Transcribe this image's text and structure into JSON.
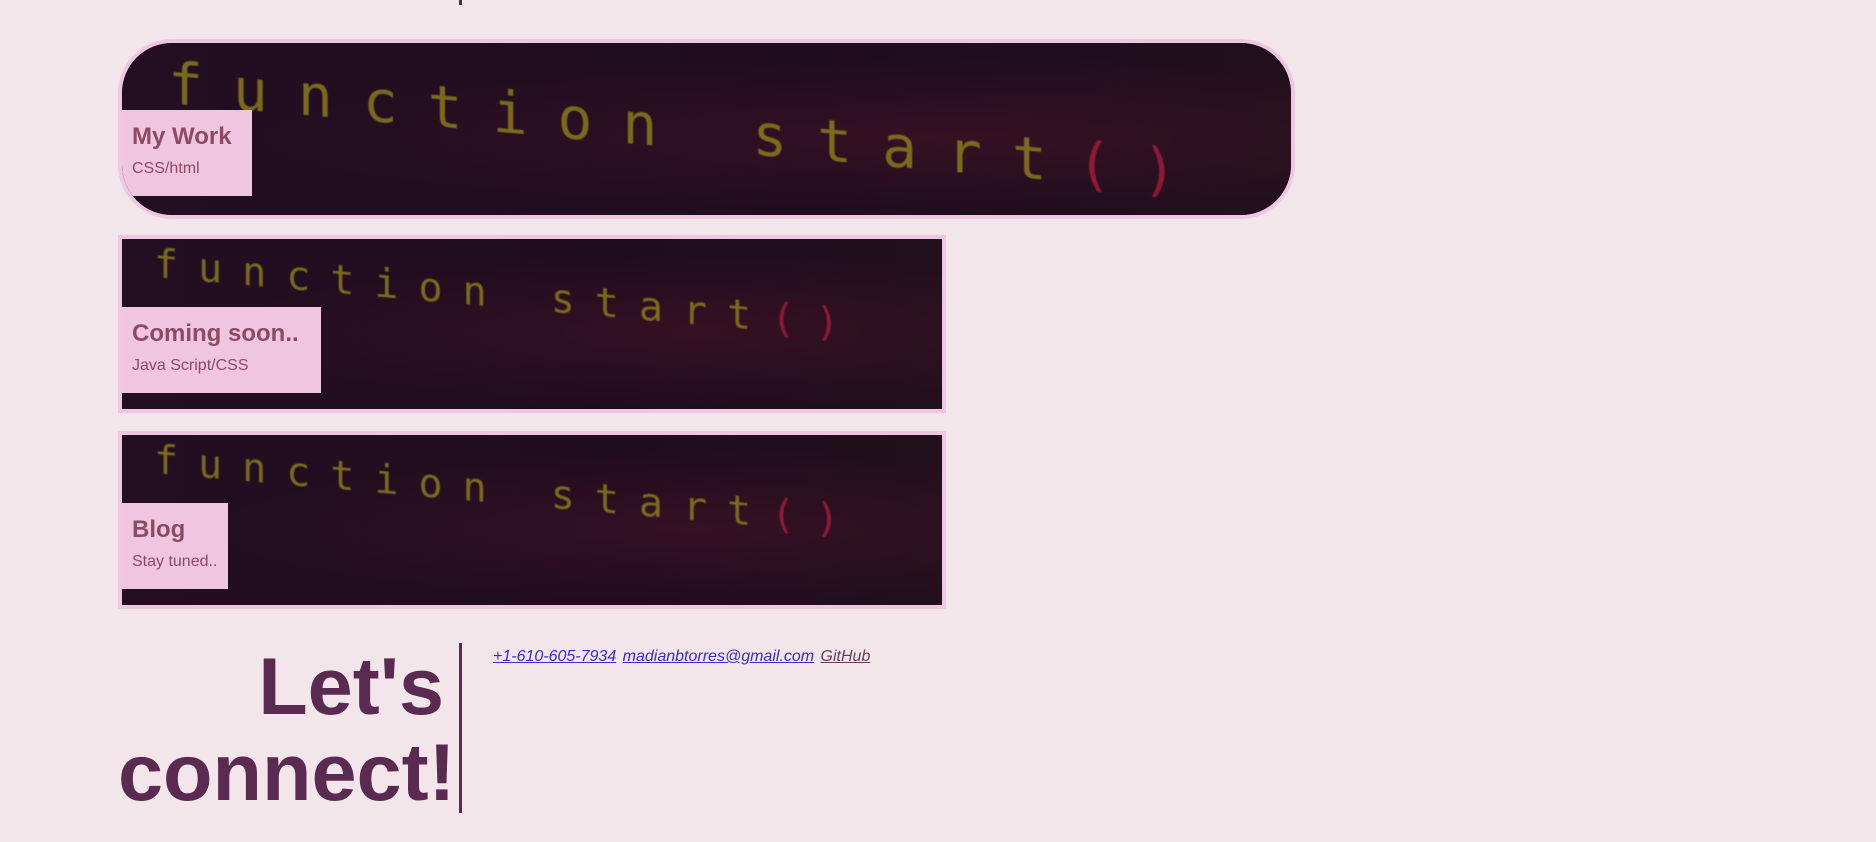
{
  "projects": [
    {
      "title": "My Work",
      "subtitle": "CSS/html",
      "code": "function start",
      "paren": "()"
    },
    {
      "title": "Coming soon..",
      "subtitle": "Java Script/CSS",
      "code": "function start",
      "paren": "()"
    },
    {
      "title": "Blog",
      "subtitle": "Stay tuned..",
      "code": "function start",
      "paren": "()"
    }
  ],
  "connect": {
    "heading_line1": "Let's",
    "heading_line2": "connect!"
  },
  "contact": {
    "phone": "+1-610-605-7934",
    "email": "madianbtorres@gmail.com",
    "github": "GitHub"
  },
  "colors": {
    "background": "#f3e6ea",
    "card_border": "#f0c7e2",
    "label_bg": "#efc5e0",
    "label_text": "#8e4a63",
    "heading": "#5a2a50",
    "link": "#3a2ad0"
  }
}
